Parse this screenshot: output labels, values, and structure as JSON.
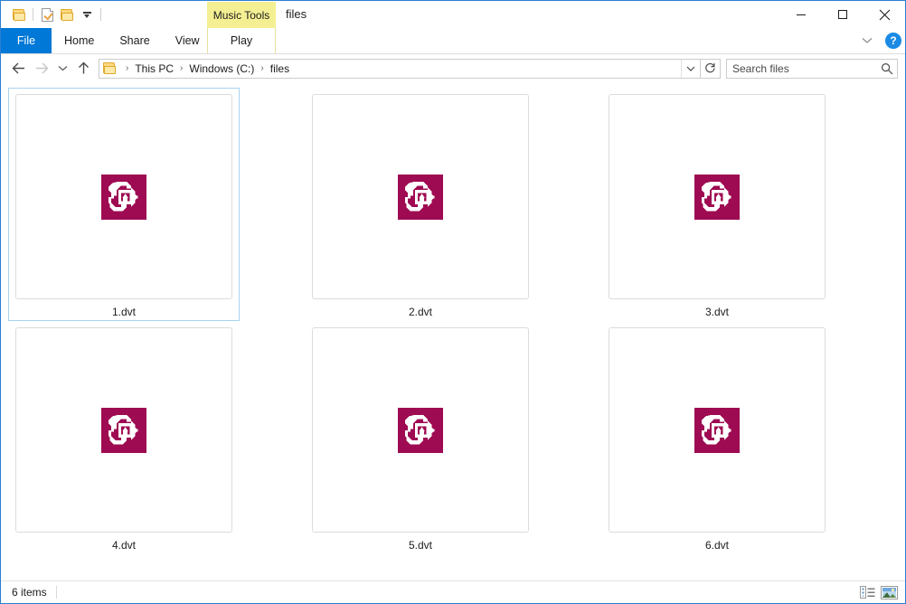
{
  "window": {
    "title": "files",
    "border_color": "#2a7fd4",
    "controls": {
      "minimize": "minimize-icon",
      "maximize": "maximize-icon",
      "close": "close-icon"
    }
  },
  "quick_access_toolbar": {
    "items": [
      {
        "name": "new-folder",
        "icon": "folder-icon"
      },
      {
        "name": "properties",
        "icon": "properties-checkmark-icon"
      },
      {
        "name": "open-folder",
        "icon": "folder-icon"
      },
      {
        "name": "customize",
        "icon": "caret-down-icon"
      }
    ]
  },
  "ribbon": {
    "contextual_group": {
      "label": "Music Tools",
      "color": "#f4ef92"
    },
    "tabs": [
      {
        "label": "File",
        "active": false,
        "style": "file"
      },
      {
        "label": "Home",
        "active": false,
        "style": "normal"
      },
      {
        "label": "Share",
        "active": false,
        "style": "normal"
      },
      {
        "label": "View",
        "active": false,
        "style": "normal"
      },
      {
        "label": "Play",
        "active": true,
        "style": "contextual"
      }
    ],
    "expand_icon": "chevron-down-icon",
    "help_label": "?",
    "accent_color": "#0078d7"
  },
  "navigation": {
    "back": "back-arrow-icon",
    "forward": "forward-arrow-icon",
    "recent": "chevron-down-icon",
    "up": "up-arrow-icon",
    "breadcrumb": {
      "icon": "folder-icon",
      "segments": [
        "This PC",
        "Windows (C:)",
        "files"
      ],
      "separator": "›",
      "dropdown": "chevron-down-icon"
    },
    "refresh": "refresh-icon"
  },
  "search": {
    "placeholder": "Search files",
    "value": "",
    "icon": "search-icon"
  },
  "files": {
    "view_mode": "extra-large-icons",
    "items": [
      {
        "name": "1.dvt",
        "selected": true,
        "icon": "dvt-file-icon"
      },
      {
        "name": "2.dvt",
        "selected": false,
        "icon": "dvt-file-icon"
      },
      {
        "name": "3.dvt",
        "selected": false,
        "icon": "dvt-file-icon"
      },
      {
        "name": "4.dvt",
        "selected": false,
        "icon": "dvt-file-icon"
      },
      {
        "name": "5.dvt",
        "selected": false,
        "icon": "dvt-file-icon"
      },
      {
        "name": "6.dvt",
        "selected": false,
        "icon": "dvt-file-icon"
      }
    ],
    "icon_colors": {
      "background": "#9e0b52",
      "glyph": "#ffffff"
    },
    "selection_border": "#a8d3f0"
  },
  "statusbar": {
    "item_count": "6 items",
    "details_view": "details-view-icon",
    "thumbnail_view": "large-icons-view-icon"
  }
}
